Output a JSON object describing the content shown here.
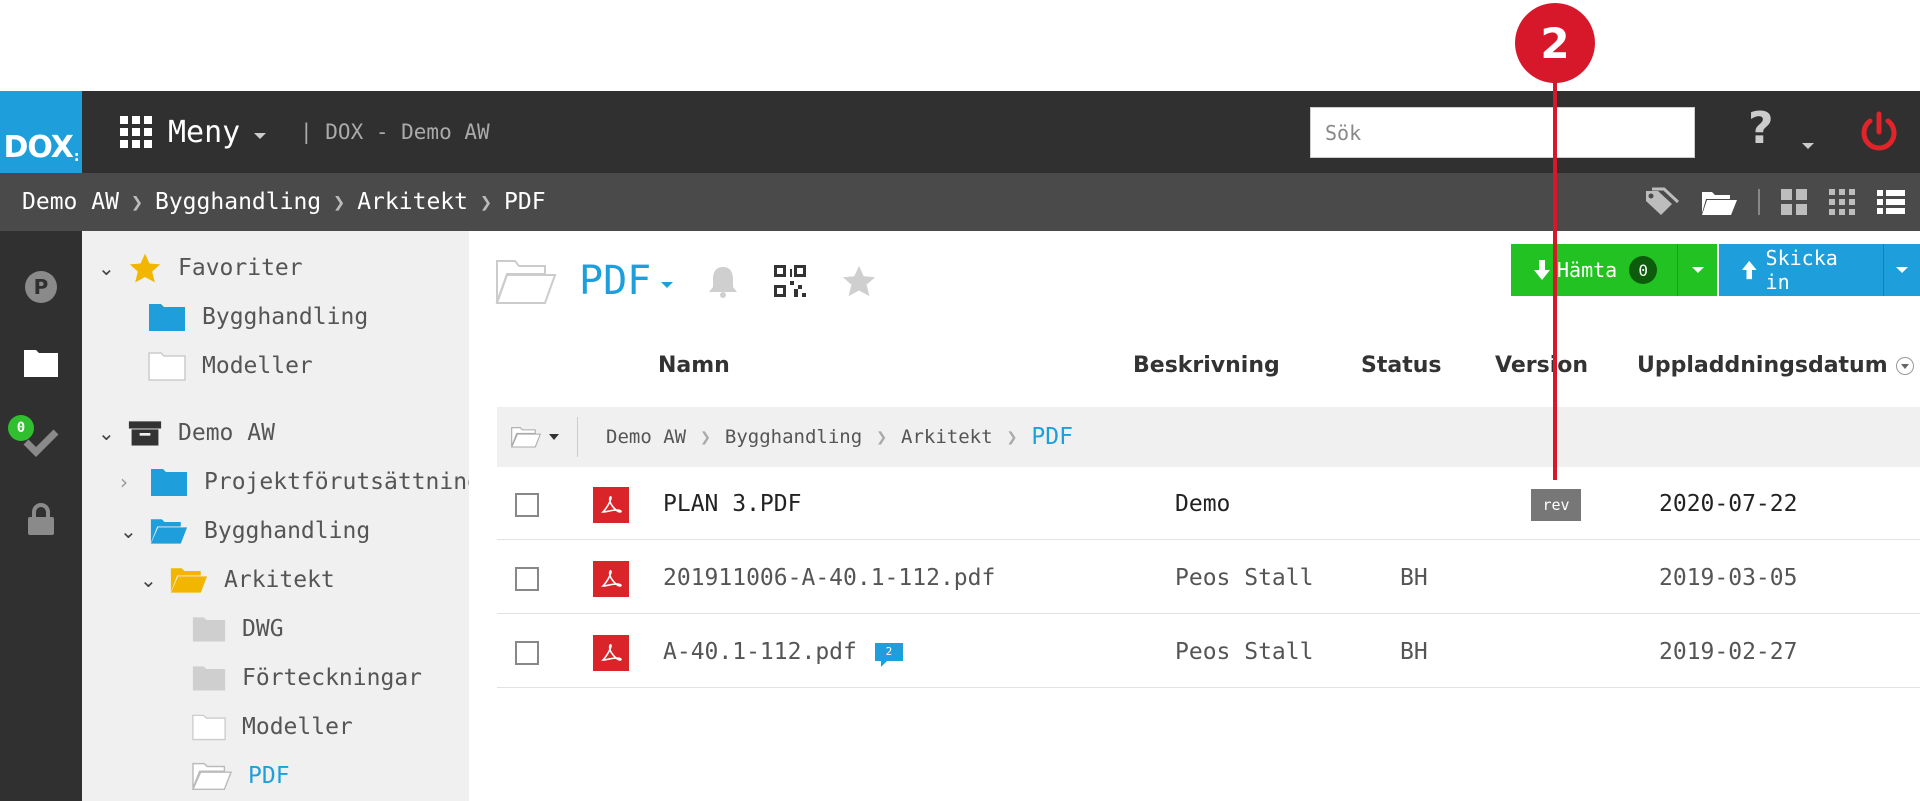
{
  "annotation": {
    "marker_label": "2"
  },
  "header": {
    "logo": "DOX",
    "menu_label": "Meny",
    "app_title": "| DOX - Demo AW",
    "search_placeholder": "Sök",
    "help_symbol": "?"
  },
  "breadcrumb": [
    "Demo AW",
    "Bygghandling",
    "Arkitekt",
    "PDF"
  ],
  "rail": {
    "check_badge": "0"
  },
  "tree": {
    "favorites": {
      "label": "Favoriter",
      "items": [
        "Bygghandling",
        "Modeller"
      ]
    },
    "project": {
      "label": "Demo AW",
      "items": [
        {
          "label": "Projektförutsättningar"
        },
        {
          "label": "Bygghandling"
        },
        {
          "label": "Arkitekt"
        },
        {
          "label": "DWG"
        },
        {
          "label": "Förteckningar"
        },
        {
          "label": "Modeller"
        },
        {
          "label": "PDF"
        }
      ]
    }
  },
  "main": {
    "folder_title": "PDF",
    "download_button": {
      "label": "Hämta",
      "count": "0"
    },
    "upload_button": {
      "label": "Skicka in"
    },
    "columns": [
      "Namn",
      "Beskrivning",
      "Status",
      "Version",
      "Uppladdningsdatum"
    ],
    "path": [
      "Demo AW",
      "Bygghandling",
      "Arkitekt",
      "PDF"
    ],
    "files": [
      {
        "name": "PLAN 3.PDF",
        "description": "Demo",
        "status": "",
        "version": "rev",
        "date": "2020-07-22"
      },
      {
        "name": "201911006-A-40.1-112.pdf",
        "description": "Peos Stall",
        "status": "BH",
        "version": "",
        "date": "2019-03-05"
      },
      {
        "name": "A-40.1-112.pdf",
        "description": "Peos Stall",
        "status": "BH",
        "version": "",
        "date": "2019-02-27",
        "comments": "2"
      }
    ]
  },
  "colors": {
    "accent_blue": "#1e9fdc",
    "download_green": "#21c221",
    "marker_red": "#d7182a",
    "pdf_red": "#d9242a",
    "favorite_star": "#f2b600",
    "arkitekt_folder": "#f2b600"
  }
}
